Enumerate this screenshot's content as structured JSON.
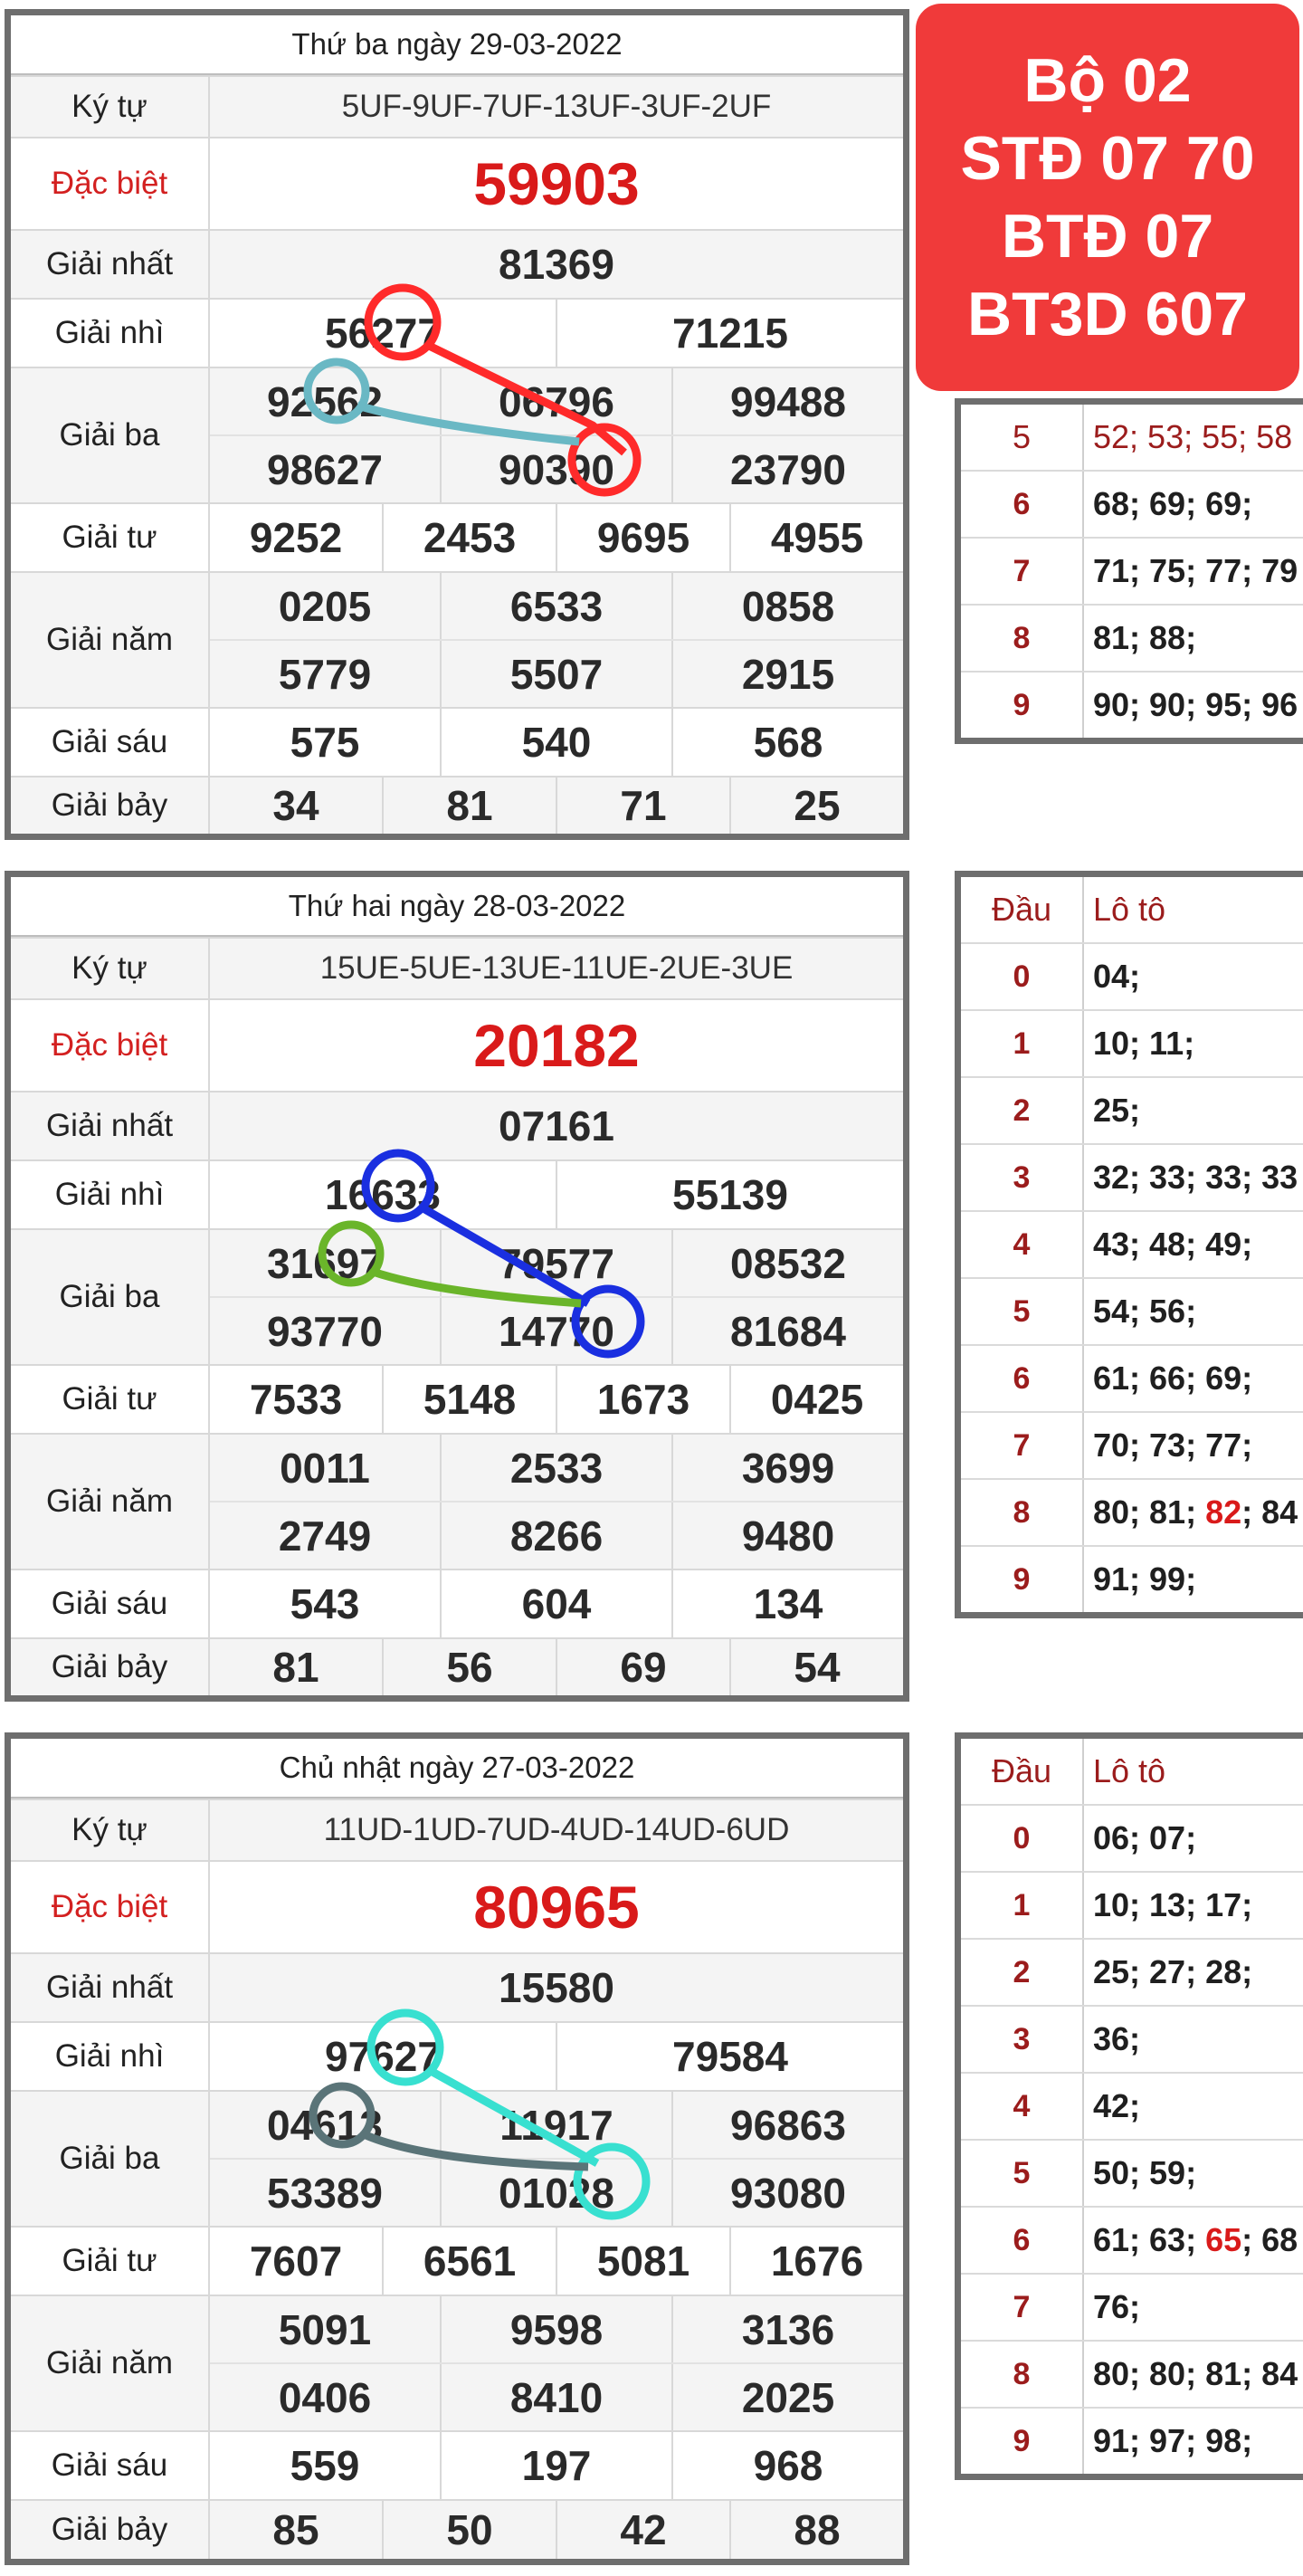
{
  "badge": {
    "lines": [
      "Bộ 02",
      "STĐ 07 70",
      "BTĐ 07",
      "BT3D 607"
    ]
  },
  "labels": {
    "ky_tu": "Ký tự",
    "dac_biet": "Đặc biệt",
    "giai_nhat": "Giải nhất",
    "giai_nhi": "Giải nhì",
    "giai_ba": "Giải ba",
    "giai_tu": "Giải tư",
    "giai_nam": "Giải năm",
    "giai_sau": "Giải sáu",
    "giai_bay": "Giải bảy"
  },
  "results": [
    {
      "date": "Thứ ba ngày 29-03-2022",
      "ky_tu": "5UF-9UF-7UF-13UF-3UF-2UF",
      "dac_biet": "59903",
      "giai_nhat": "81369",
      "giai_nhi": [
        "56277",
        "71215"
      ],
      "giai_ba": [
        "92562",
        "06796",
        "99488",
        "98627",
        "90390",
        "23790"
      ],
      "giai_tu": [
        "9252",
        "2453",
        "9695",
        "4955"
      ],
      "giai_nam": [
        "0205",
        "6533",
        "0858",
        "5779",
        "5507",
        "2915"
      ],
      "giai_sau": [
        "575",
        "540",
        "568"
      ],
      "giai_bay": [
        "34",
        "81",
        "71",
        "25"
      ]
    },
    {
      "date": "Thứ hai ngày 28-03-2022",
      "ky_tu": "15UE-5UE-13UE-11UE-2UE-3UE",
      "dac_biet": "20182",
      "giai_nhat": "07161",
      "giai_nhi": [
        "16633",
        "55139"
      ],
      "giai_ba": [
        "31697",
        "79577",
        "08532",
        "93770",
        "14770",
        "81684"
      ],
      "giai_tu": [
        "7533",
        "5148",
        "1673",
        "0425"
      ],
      "giai_nam": [
        "0011",
        "2533",
        "3699",
        "2749",
        "8266",
        "9480"
      ],
      "giai_sau": [
        "543",
        "604",
        "134"
      ],
      "giai_bay": [
        "81",
        "56",
        "69",
        "54"
      ]
    },
    {
      "date": "Chủ nhật ngày 27-03-2022",
      "ky_tu": "11UD-1UD-7UD-4UD-14UD-6UD",
      "dac_biet": "80965",
      "giai_nhat": "15580",
      "giai_nhi": [
        "97627",
        "79584"
      ],
      "giai_ba": [
        "04613",
        "11917",
        "96863",
        "53389",
        "01028",
        "93080"
      ],
      "giai_tu": [
        "7607",
        "6561",
        "5081",
        "1676"
      ],
      "giai_nam": [
        "5091",
        "9598",
        "3136",
        "0406",
        "8410",
        "2025"
      ],
      "giai_sau": [
        "559",
        "197",
        "968"
      ],
      "giai_bay": [
        "85",
        "50",
        "42",
        "88"
      ]
    }
  ],
  "loto_header": {
    "dau": "Đầu",
    "loto": "Lô tô"
  },
  "loto": [
    {
      "rows": [
        {
          "dau": "5",
          "val": "52; 53; 55; 58"
        },
        {
          "dau": "6",
          "val": "68; 69; 69;"
        },
        {
          "dau": "7",
          "val": "71; 75; 77; 79"
        },
        {
          "dau": "8",
          "val": "81; 88;"
        },
        {
          "dau": "9",
          "val": "90; 90; 95; 96"
        }
      ]
    },
    {
      "rows": [
        {
          "dau": "0",
          "val": "04;"
        },
        {
          "dau": "1",
          "val": "10; 11;"
        },
        {
          "dau": "2",
          "val": "25;"
        },
        {
          "dau": "3",
          "val": "32; 33; 33; 33"
        },
        {
          "dau": "4",
          "val": "43; 48; 49;"
        },
        {
          "dau": "5",
          "val": "54; 56;"
        },
        {
          "dau": "6",
          "val": "61; 66; 69;"
        },
        {
          "dau": "7",
          "val": "70; 73; 77;"
        },
        {
          "dau": "8",
          "val_pre": "80; 81;",
          "val_hl": "82",
          "val_post": "; 84"
        },
        {
          "dau": "9",
          "val": "91; 99;"
        }
      ]
    },
    {
      "rows": [
        {
          "dau": "0",
          "val": "06; 07;"
        },
        {
          "dau": "1",
          "val": "10; 13; 17;"
        },
        {
          "dau": "2",
          "val": "25; 27; 28;"
        },
        {
          "dau": "3",
          "val": "36;"
        },
        {
          "dau": "4",
          "val": "42;"
        },
        {
          "dau": "5",
          "val": "50; 59;"
        },
        {
          "dau": "6",
          "val_pre": "61; 63;",
          "val_hl": "65",
          "val_post": "; 68"
        },
        {
          "dau": "7",
          "val": "76;"
        },
        {
          "dau": "8",
          "val": "80; 80; 81; 84"
        },
        {
          "dau": "9",
          "val": "91; 97; 98;"
        }
      ]
    }
  ],
  "colors": {
    "badge": "#f03a3a",
    "special": "#d91a1a",
    "ann_red": "#ff2a2a",
    "ann_teal": "#6ab8c4",
    "ann_blue": "#1a2fe0",
    "ann_green": "#6ab52a",
    "ann_cyan": "#38e0d0",
    "ann_slate": "#5a7478"
  }
}
